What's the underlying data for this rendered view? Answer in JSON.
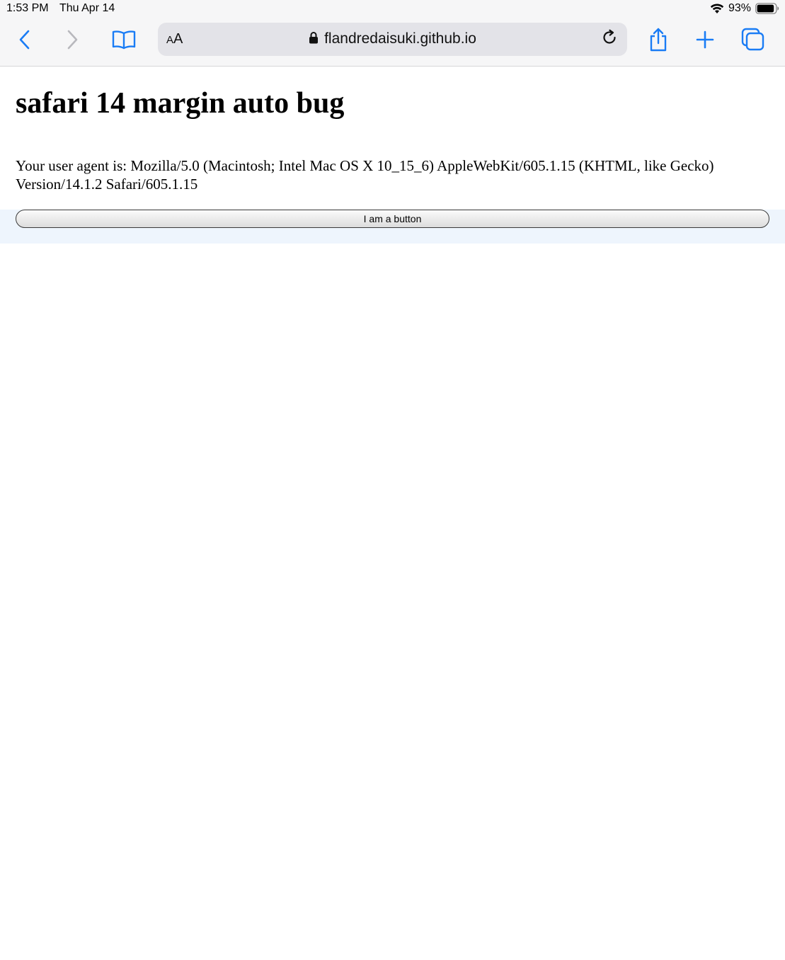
{
  "status_bar": {
    "time": "1:53 PM",
    "date": "Thu Apr 14",
    "battery_percent": "93%",
    "battery_level": 0.93
  },
  "toolbar": {
    "icons": {
      "back": "chevron-left-icon",
      "forward": "chevron-right-icon",
      "bookmarks": "book-icon",
      "share": "share-icon",
      "new_tab": "plus-icon",
      "tabs": "tabs-icon"
    },
    "address_bar": {
      "reader_label": "AA",
      "url": "flandredaisuki.github.io",
      "secure": true
    }
  },
  "page": {
    "title": "safari 14 margin auto bug",
    "user_agent_text": "Your user agent is: Mozilla/5.0 (Macintosh; Intel Mac OS X 10_15_6) AppleWebKit/605.1.15 (KHTML, like Gecko) Version/14.1.2 Safari/605.1.15",
    "button_label": "I am a button"
  },
  "colors": {
    "accent": "#1a7cf5",
    "chrome_background": "#f6f6f7",
    "address_field": "#e3e3e8",
    "button_band": "#eef5fd"
  }
}
